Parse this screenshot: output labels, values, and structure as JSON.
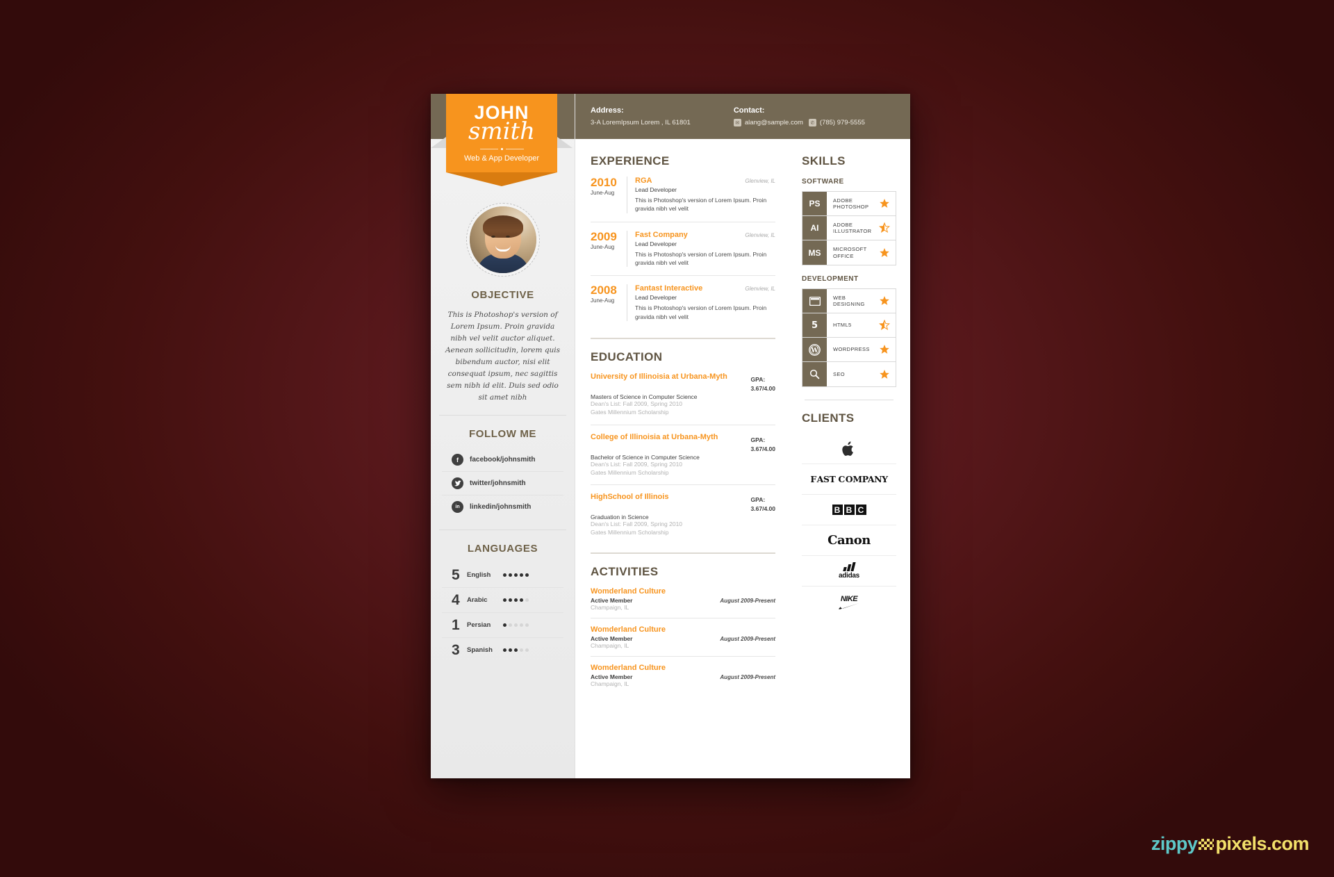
{
  "header": {
    "address_label": "Address:",
    "address_value": "3-A LoremIpsum Lorem , IL 61801",
    "contact_label": "Contact:",
    "email": "alang@sample.com",
    "phone": "(785) 979-5555",
    "email_icon": "envelope-icon",
    "phone_icon": "phone-icon"
  },
  "banner": {
    "first_name": "JOHN",
    "last_name": "smith",
    "role": "Web & App Developer"
  },
  "sidebar": {
    "objective": {
      "title": "OBJECTIVE",
      "text": "This is Photoshop's version of Lorem Ipsum. Proin gravida nibh vel velit auctor aliquet. Aenean sollicitudin, lorem quis bibendum auctor, nisi elit consequat ipsum, nec sagittis sem nibh id elit. Duis sed odio sit amet nibh"
    },
    "follow": {
      "title": "FOLLOW ME",
      "items": [
        {
          "icon": "facebook-icon",
          "glyph": "f",
          "label": "facebook/johnsmith"
        },
        {
          "icon": "twitter-icon",
          "glyph": "t",
          "label": "twitter/johnsmith"
        },
        {
          "icon": "linkedin-icon",
          "glyph": "in",
          "label": "linkedin/johnsmith"
        }
      ]
    },
    "languages": {
      "title": "LANGUAGES",
      "max": 5,
      "items": [
        {
          "score": "5",
          "name": "English",
          "level": 5
        },
        {
          "score": "4",
          "name": "Arabic",
          "level": 4
        },
        {
          "score": "1",
          "name": "Persian",
          "level": 1
        },
        {
          "score": "3",
          "name": "Spanish",
          "level": 3
        }
      ]
    }
  },
  "experience": {
    "title": "EXPERIENCE",
    "items": [
      {
        "year": "2010",
        "months": "June-Aug",
        "company": "RGA",
        "location": "Glenview, IL",
        "role": "Lead Developer",
        "description": "This is Photoshop's version  of Lorem Ipsum. Proin gravida nibh vel velit"
      },
      {
        "year": "2009",
        "months": "June-Aug",
        "company": "Fast Company",
        "location": "Glenview, IL",
        "role": "Lead Developer",
        "description": "This is Photoshop's version  of Lorem Ipsum. Proin gravida nibh vel velit"
      },
      {
        "year": "2008",
        "months": "June-Aug",
        "company": "Fantast Interactive",
        "location": "Glenview, IL",
        "role": "Lead Developer",
        "description": "This is Photoshop's version  of Lorem Ipsum. Proin gravida nibh vel velit"
      }
    ]
  },
  "education": {
    "title": "EDUCATION",
    "gpa_label": "GPA:",
    "items": [
      {
        "school": "University of Illinoisia at Urbana-Myth",
        "degree": "Masters of Science in Computer Science",
        "gpa": "3.67/4.00",
        "note1": "Dean's List: Fall 2009, Spring 2010",
        "note2": "Gates Millennium Scholarship"
      },
      {
        "school": "College of Illinoisia at Urbana-Myth",
        "degree": "Bachelor of Science in Computer Science",
        "gpa": "3.67/4.00",
        "note1": "Dean's List: Fall 2009, Spring 2010",
        "note2": "Gates Millennium Scholarship"
      },
      {
        "school": "HighSchool of Illinois",
        "degree": "Graduation in Science",
        "gpa": "3.67/4.00",
        "note1": "Dean's List: Fall 2009, Spring 2010",
        "note2": "Gates Millennium Scholarship"
      }
    ]
  },
  "activities": {
    "title": "ACTIVITIES",
    "items": [
      {
        "name": "Womderland Culture",
        "role": "Active Member",
        "date": "August 2009-Present",
        "location": "Champaign, IL"
      },
      {
        "name": "Womderland Culture",
        "role": "Active Member",
        "date": "August 2009-Present",
        "location": "Champaign, IL"
      },
      {
        "name": "Womderland Culture",
        "role": "Active Member",
        "date": "August 2009-Present",
        "location": "Champaign, IL"
      }
    ]
  },
  "skills": {
    "title": "SKILLS",
    "software": {
      "subtitle": "SOFTWARE",
      "items": [
        {
          "badge": "PS",
          "icon": "photoshop-icon",
          "name": "ADOBE\nPHOTOSHOP",
          "rating": "full"
        },
        {
          "badge": "AI",
          "icon": "illustrator-icon",
          "name": "ADOBE\nILLUSTRATOR",
          "rating": "half"
        },
        {
          "badge": "MS",
          "icon": "microsoft-office-icon",
          "name": "MICROSOFT\nOFFICE",
          "rating": "full"
        }
      ]
    },
    "development": {
      "subtitle": "DEVELOPMENT",
      "items": [
        {
          "badge": "",
          "icon": "browser-window-icon",
          "name": "WEB\nDESIGNING",
          "rating": "full"
        },
        {
          "badge": "5",
          "icon": "html5-icon",
          "name": "HTML5",
          "rating": "half"
        },
        {
          "badge": "",
          "icon": "wordpress-icon",
          "name": "WORDPRESS",
          "rating": "full"
        },
        {
          "badge": "",
          "icon": "search-icon",
          "name": "SEO",
          "rating": "full"
        }
      ]
    }
  },
  "clients": {
    "title": "CLIENTS",
    "items": [
      {
        "logo": "apple-logo",
        "name": "Apple"
      },
      {
        "logo": "fast-company-logo",
        "name": "FAST COMPANY"
      },
      {
        "logo": "bbc-logo",
        "name": "BBC"
      },
      {
        "logo": "canon-logo",
        "name": "Canon"
      },
      {
        "logo": "adidas-logo",
        "name": "adidas"
      },
      {
        "logo": "nike-logo",
        "name": "NIKE"
      }
    ]
  },
  "watermark": {
    "part1": "zippy",
    "part2": "pixels.com",
    "color1": "#5ec8c8",
    "color2": "#f2e06a"
  },
  "colors": {
    "accent_orange": "#f7941e",
    "header_brown": "#746954",
    "backdrop": "#4a1418"
  }
}
